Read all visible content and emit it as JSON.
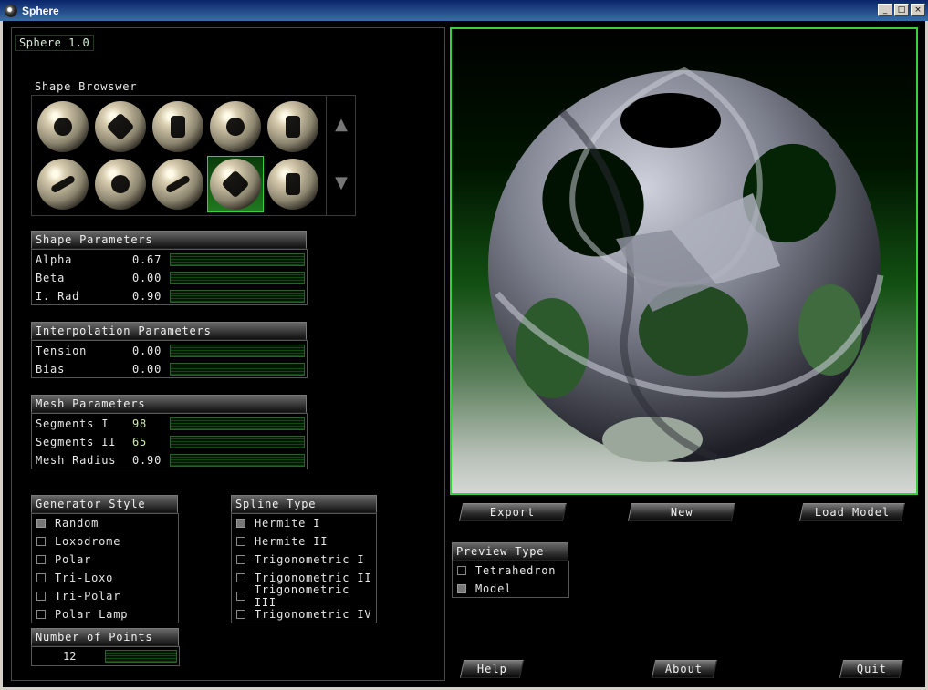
{
  "window": {
    "title": "Sphere",
    "controls": [
      "_",
      "□",
      "×"
    ]
  },
  "app": {
    "title": "Sphere 1.0"
  },
  "shape_browser": {
    "title": "Shape Browswer",
    "selected_index": 8,
    "up_icon": "arrow-up-icon",
    "down_icon": "arrow-down-icon"
  },
  "shape_parameters": {
    "title": "Shape Parameters",
    "rows": [
      {
        "label": "Alpha",
        "value": "0.67"
      },
      {
        "label": "Beta",
        "value": "0.00"
      },
      {
        "label": "I. Rad",
        "value": "0.90"
      }
    ]
  },
  "interpolation_parameters": {
    "title": "Interpolation Parameters",
    "rows": [
      {
        "label": "Tension",
        "value": "0.00"
      },
      {
        "label": "Bias",
        "value": "0.00"
      }
    ]
  },
  "mesh_parameters": {
    "title": "Mesh Parameters",
    "rows": [
      {
        "label": "Segments I",
        "value": "98"
      },
      {
        "label": "Segments II",
        "value": "65"
      },
      {
        "label": "Mesh Radius",
        "value": "0.90"
      }
    ]
  },
  "generator_style": {
    "title": "Generator Style",
    "items": [
      {
        "label": "Random",
        "checked": true
      },
      {
        "label": "Loxodrome",
        "checked": false
      },
      {
        "label": "Polar",
        "checked": false
      },
      {
        "label": "Tri-Loxo",
        "checked": false
      },
      {
        "label": "Tri-Polar",
        "checked": false
      },
      {
        "label": "Polar Lamp",
        "checked": false
      }
    ]
  },
  "spline_type": {
    "title": "Spline Type",
    "items": [
      {
        "label": "Hermite I",
        "checked": true
      },
      {
        "label": "Hermite II",
        "checked": false
      },
      {
        "label": "Trigonometric I",
        "checked": false
      },
      {
        "label": "Trigonometric II",
        "checked": false
      },
      {
        "label": "Trigonometric III",
        "checked": false
      },
      {
        "label": "Trigonometric IV",
        "checked": false
      }
    ]
  },
  "number_of_points": {
    "title": "Number of Points",
    "value": "12"
  },
  "preview_type": {
    "title": "Preview Type",
    "items": [
      {
        "label": "Tetrahedron",
        "checked": false
      },
      {
        "label": "Model",
        "checked": true
      }
    ]
  },
  "buttons": {
    "export": "Export",
    "new": "New",
    "load_model": "Load Model",
    "help": "Help",
    "about": "About",
    "quit": "Quit"
  },
  "colors": {
    "accent_green": "#38d03a",
    "bar_green": "#0e4a10"
  }
}
